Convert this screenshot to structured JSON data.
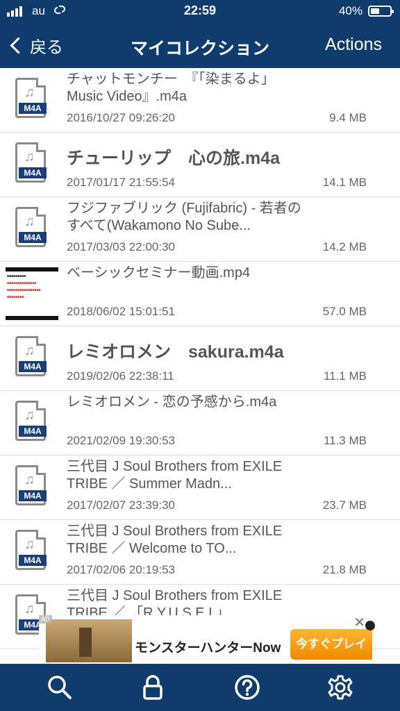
{
  "status": {
    "carrier": "au",
    "time": "22:59",
    "battery": "40%"
  },
  "nav": {
    "back": "戻る",
    "title": "マイコレクション",
    "actions": "Actions"
  },
  "files": [
    {
      "name": "チャットモンチー　『「染まるよ」Music Video』.m4a",
      "date": "2016/10/27 09:26:20",
      "size": "9.4 MB",
      "type": "M4A",
      "big": false
    },
    {
      "name": "チューリップ　心の旅.m4a",
      "date": "2017/01/17 21:55:54",
      "size": "14.1 MB",
      "type": "M4A",
      "big": true
    },
    {
      "name": "フジファブリック (Fujifabric) - 若者のすべて(Wakamono No Sube...",
      "date": "2017/03/03 22:00:30",
      "size": "14.2 MB",
      "type": "M4A",
      "big": false
    },
    {
      "name": "ベーシックセミナー動画.mp4",
      "date": "2018/06/02 15:01:51",
      "size": "57.0 MB",
      "type": "video",
      "big": false
    },
    {
      "name": "レミオロメン　sakura.m4a",
      "date": "2019/02/06 22:38:11",
      "size": "11.1 MB",
      "type": "M4A",
      "big": true
    },
    {
      "name": "レミオロメン - 恋の予感から.m4a",
      "date": "2021/02/09 19:30:53",
      "size": "11.3 MB",
      "type": "M4A",
      "big": false
    },
    {
      "name": "三代目 J Soul Brothers from EXILE TRIBE ／ Summer Madn...",
      "date": "2017/02/07 23:39:30",
      "size": "23.7 MB",
      "type": "M4A",
      "big": false
    },
    {
      "name": "三代目 J Soul Brothers from EXILE TRIBE ／ Welcome to TO...",
      "date": "2017/02/06 20:19:53",
      "size": "21.8 MB",
      "type": "M4A",
      "big": false
    },
    {
      "name": "三代目 J Soul Brothers from EXILE TRIBE ／ 「R.Y.U.S.E.I.」...",
      "date": "",
      "size": "",
      "type": "M4A",
      "big": false
    }
  ],
  "ad": {
    "tag": "AD",
    "text": "モンスターハンターNow",
    "button": "今すぐプレイ"
  },
  "tabs": [
    "search-icon",
    "lock-icon",
    "help-icon",
    "settings-icon"
  ]
}
